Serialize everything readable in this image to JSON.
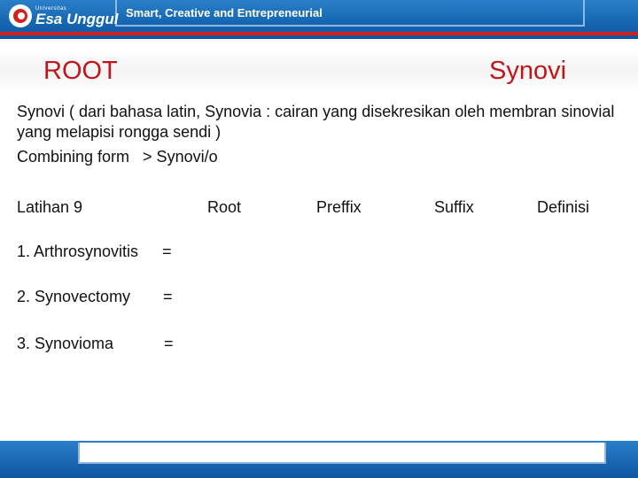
{
  "header": {
    "logo_small": "Universitas",
    "logo_name": "Esa Unggul",
    "tagline": "Smart, Creative and Entrepreneurial"
  },
  "slide": {
    "title_left": "ROOT",
    "title_right": "Synovi",
    "paragraph": "Synovi ( dari bahasa latin, Synovia : cairan yang disekresikan oleh membran sinovial yang melapisi rongga sendi )",
    "combining": "Combining form   > Synovi/o",
    "exercise": "Latihan 9",
    "columns": [
      "Root",
      "Preffix",
      "Suffix",
      "Definisi"
    ],
    "items": [
      {
        "term": "1. Arthrosynovitis",
        "eq": "="
      },
      {
        "term": "2. Synovectomy",
        "eq": "="
      },
      {
        "term": "3. Synovioma",
        "eq": "="
      }
    ]
  }
}
